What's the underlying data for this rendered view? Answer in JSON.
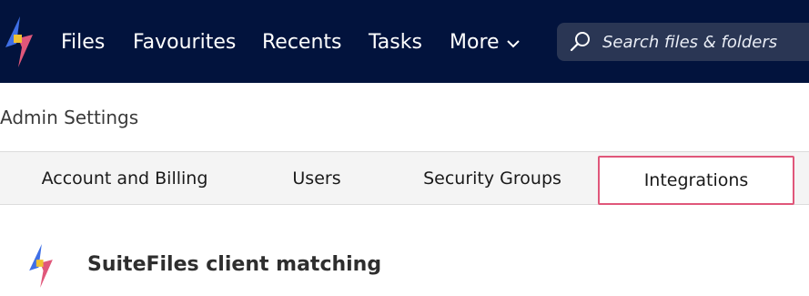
{
  "header": {
    "nav": [
      {
        "label": "Files"
      },
      {
        "label": "Favourites"
      },
      {
        "label": "Recents"
      },
      {
        "label": "Tasks"
      }
    ],
    "more_label": "More",
    "search_placeholder": "Search files & folders",
    "icons": {
      "logo": "suitefiles-logo-icon",
      "more": "chevron-down-icon",
      "search": "search-icon"
    }
  },
  "page": {
    "title": "Admin Settings"
  },
  "tabs": [
    {
      "label": "Account and Billing",
      "active": false
    },
    {
      "label": "Users",
      "active": false
    },
    {
      "label": "Security Groups",
      "active": false
    },
    {
      "label": "Integrations",
      "active": true
    }
  ],
  "section": {
    "title": "SuiteFiles client matching"
  },
  "colors": {
    "topbar": "#02133d",
    "search_bg": "#2a3654",
    "active_tab_border": "#e0577a",
    "logo_blue": "#3f6fe6",
    "logo_pink": "#e0577a",
    "logo_yellow": "#f0c132"
  }
}
